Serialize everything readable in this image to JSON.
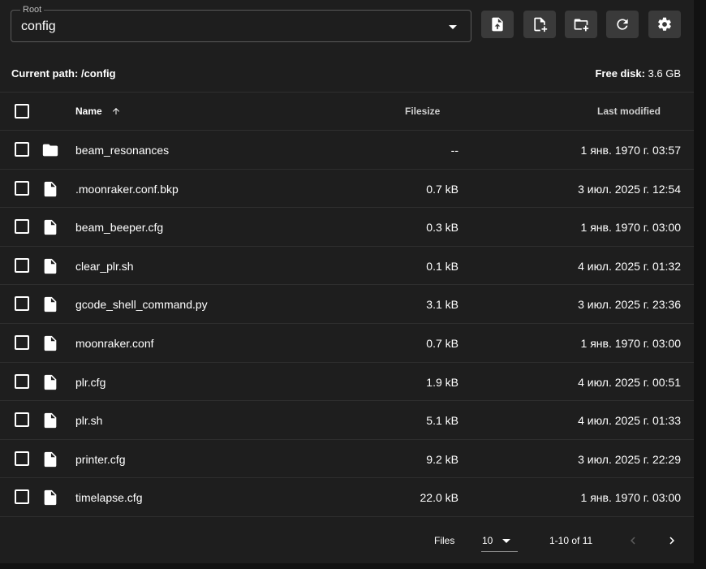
{
  "root_select": {
    "label": "Root",
    "value": "config"
  },
  "toolbar": [
    {
      "name": "upload-file-button",
      "icon": "file-upload-icon"
    },
    {
      "name": "new-file-button",
      "icon": "file-plus-icon"
    },
    {
      "name": "new-folder-button",
      "icon": "folder-plus-icon"
    },
    {
      "name": "refresh-button",
      "icon": "refresh-icon"
    },
    {
      "name": "settings-button",
      "icon": "gear-icon"
    }
  ],
  "path_bar": {
    "label": "Current path:",
    "path": "/config",
    "disk_label": "Free disk:",
    "disk_value": "3.6 GB"
  },
  "table": {
    "headers": {
      "name": "Name",
      "filesize": "Filesize",
      "modified": "Last modified"
    },
    "sort": "asc",
    "rows": [
      {
        "type": "folder",
        "name": "beam_resonances",
        "size": "--",
        "modified": "1 янв. 1970 г. 03:57"
      },
      {
        "type": "file",
        "name": ".moonraker.conf.bkp",
        "size": "0.7 kB",
        "modified": "3 июл. 2025 г. 12:54"
      },
      {
        "type": "file",
        "name": "beam_beeper.cfg",
        "size": "0.3 kB",
        "modified": "1 янв. 1970 г. 03:00"
      },
      {
        "type": "file",
        "name": "clear_plr.sh",
        "size": "0.1 kB",
        "modified": "4 июл. 2025 г. 01:32"
      },
      {
        "type": "file",
        "name": "gcode_shell_command.py",
        "size": "3.1 kB",
        "modified": "3 июл. 2025 г. 23:36"
      },
      {
        "type": "file",
        "name": "moonraker.conf",
        "size": "0.7 kB",
        "modified": "1 янв. 1970 г. 03:00"
      },
      {
        "type": "file",
        "name": "plr.cfg",
        "size": "1.9 kB",
        "modified": "4 июл. 2025 г. 00:51"
      },
      {
        "type": "file",
        "name": "plr.sh",
        "size": "5.1 kB",
        "modified": "4 июл. 2025 г. 01:33"
      },
      {
        "type": "file",
        "name": "printer.cfg",
        "size": "9.2 kB",
        "modified": "3 июл. 2025 г. 22:29"
      },
      {
        "type": "file",
        "name": "timelapse.cfg",
        "size": "22.0 kB",
        "modified": "1 янв. 1970 г. 03:00"
      }
    ]
  },
  "footer": {
    "files_label": "Files",
    "per_page": "10",
    "range": "1-10 of 11"
  },
  "colors": {
    "background": "#1e1e1e",
    "button": "#3a3a3a",
    "text": "#ffffff"
  }
}
